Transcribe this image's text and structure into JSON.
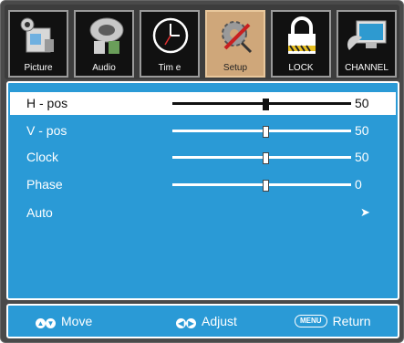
{
  "tabs": [
    {
      "label": "Picture",
      "icon": "picture-icon",
      "active": false
    },
    {
      "label": "Audio",
      "icon": "audio-icon",
      "active": false
    },
    {
      "label": "Tim e",
      "icon": "clock-icon",
      "active": false
    },
    {
      "label": "Setup",
      "icon": "setup-icon",
      "active": true
    },
    {
      "label": "LOCK",
      "icon": "lock-icon",
      "active": false
    },
    {
      "label": "CHANNEL",
      "icon": "channel-icon",
      "active": false
    }
  ],
  "settings": [
    {
      "name": "H - pos",
      "value": "50",
      "level": 0.52,
      "selected": true
    },
    {
      "name": "V - pos",
      "value": "50",
      "level": 0.52,
      "selected": false
    },
    {
      "name": "Clock",
      "value": "50",
      "level": 0.52,
      "selected": false
    },
    {
      "name": "Phase",
      "value": "0",
      "level": 0.52,
      "selected": false
    },
    {
      "name": "Auto",
      "value": "➤",
      "selected": false
    }
  ],
  "footer": {
    "move_label": "Move",
    "adjust_label": "Adjust",
    "return_label": "Return",
    "menu_key": "MENU"
  },
  "colors": {
    "panel": "#2a9ad6",
    "active_tab": "#cfa77a"
  }
}
